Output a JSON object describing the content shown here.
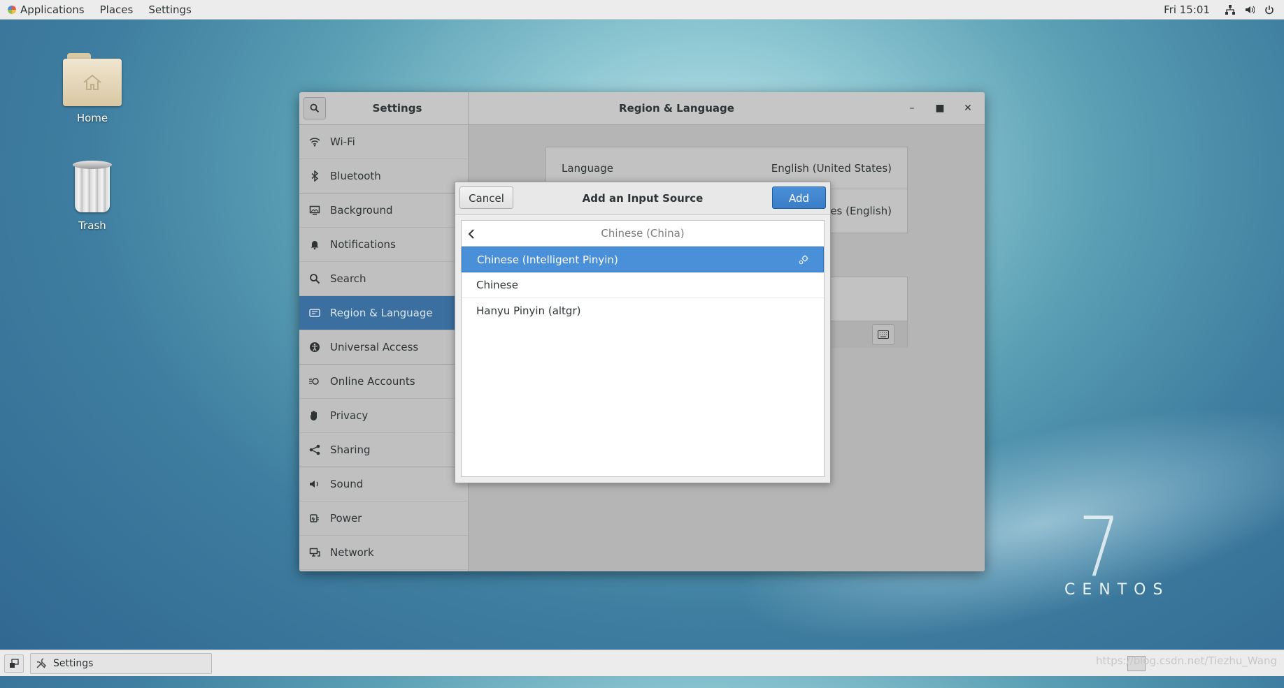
{
  "topbar": {
    "menus": [
      "Applications",
      "Places",
      "Settings"
    ],
    "clock": "Fri 15:01"
  },
  "desktop": {
    "home_label": "Home",
    "trash_label": "Trash",
    "brand_number": "7",
    "brand_text": "CENTOS"
  },
  "settings_window": {
    "sidebar_title": "Settings",
    "panel_title": "Region & Language",
    "sidebar_items": [
      {
        "label": "Wi-Fi",
        "icon": "wifi-icon"
      },
      {
        "label": "Bluetooth",
        "icon": "bluetooth-icon"
      },
      {
        "label": "Background",
        "icon": "background-icon"
      },
      {
        "label": "Notifications",
        "icon": "bell-icon"
      },
      {
        "label": "Search",
        "icon": "search-icon"
      },
      {
        "label": "Region & Language",
        "icon": "flag-icon",
        "selected": true
      },
      {
        "label": "Universal Access",
        "icon": "accessibility-icon"
      },
      {
        "label": "Online Accounts",
        "icon": "online-accounts-icon"
      },
      {
        "label": "Privacy",
        "icon": "hand-icon"
      },
      {
        "label": "Sharing",
        "icon": "share-icon"
      },
      {
        "label": "Sound",
        "icon": "speaker-icon"
      },
      {
        "label": "Power",
        "icon": "power-plug-icon"
      },
      {
        "label": "Network",
        "icon": "network-icon"
      }
    ],
    "language_label": "Language",
    "language_value": "English (United States)",
    "formats_value_partial": "tates (English)"
  },
  "dialog": {
    "title": "Add an Input Source",
    "cancel_label": "Cancel",
    "add_label": "Add",
    "group_header": "Chinese (China)",
    "items": [
      "Chinese (Intelligent Pinyin)",
      "Chinese",
      "Hanyu Pinyin (altgr)"
    ],
    "selected_index": 0
  },
  "taskbar": {
    "task_label": "Settings",
    "watermark": "https://blog.csdn.net/Tiezhu_Wang"
  },
  "colors": {
    "accent": "#4a90d9",
    "sidebar_selected": "#3b6f9f"
  }
}
